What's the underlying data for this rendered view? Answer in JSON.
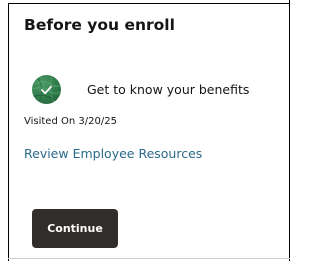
{
  "card": {
    "title": "Before you enroll"
  },
  "task": {
    "label": "Get to know your benefits",
    "status": "completed",
    "status_icon": "checkmark-icon",
    "status_color": "#2f7a4a"
  },
  "visited": {
    "label": "Visited On",
    "date": "3/20/25"
  },
  "links": {
    "resources": "Review Employee Resources"
  },
  "actions": {
    "continue_label": "Continue"
  },
  "colors": {
    "link": "#2a6a8a",
    "button_bg": "#312d2a",
    "text": "#161513"
  }
}
